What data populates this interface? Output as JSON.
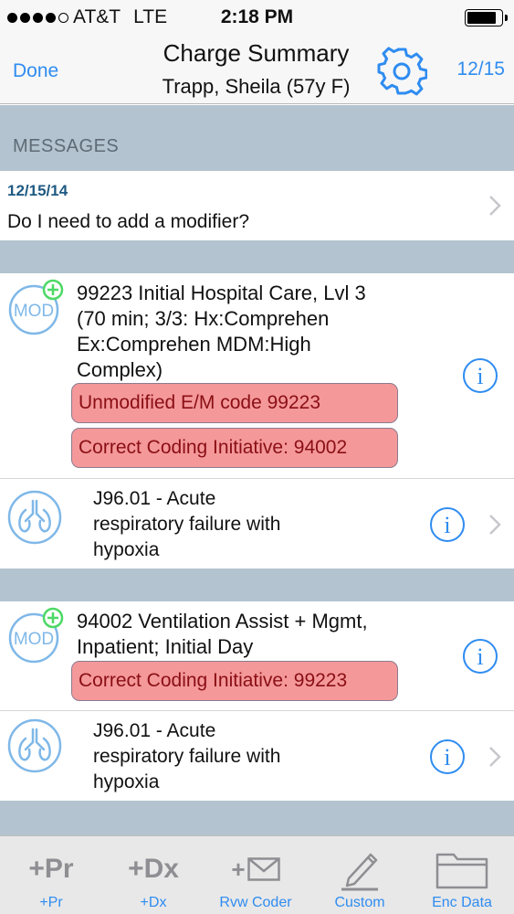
{
  "status_bar": {
    "carrier": "AT&T",
    "network": "LTE",
    "time": "2:18 PM",
    "signal_bars": 4,
    "battery_level": 0.85
  },
  "navbar": {
    "done_label": "Done",
    "title": "Charge Summary",
    "subtitle": "Trapp, Sheila (57y F)",
    "date": "12/15",
    "settings_icon": "gear-icon"
  },
  "messages": {
    "header": "MESSAGES",
    "items": [
      {
        "date": "12/15/14",
        "text": "Do I need to add a modifier?"
      }
    ]
  },
  "charges": [
    {
      "procedure": "99223 Initial Hospital Care, Lvl 3\n(70 min; 3/3: Hx:Comprehen\nEx:Comprehen   MDM:High\nComplex)",
      "alerts": [
        "Unmodified E/M code 99223",
        "Correct Coding Initiative: 94002"
      ],
      "diagnosis": "J96.01 - Acute\nrespiratory failure with\nhypoxia",
      "mod_label": "MOD"
    },
    {
      "procedure": "94002 Ventilation Assist + Mgmt,\nInpatient; Initial Day",
      "alerts": [
        "Correct Coding Initiative: 99223"
      ],
      "diagnosis": "J96.01 - Acute\nrespiratory failure with\nhypoxia",
      "mod_label": "MOD"
    }
  ],
  "tabbar": {
    "items": [
      {
        "glyph": "+Pr",
        "label": "+Pr"
      },
      {
        "glyph": "+Dx",
        "label": "+Dx"
      },
      {
        "glyph": "+",
        "label": "Rvw Coder",
        "icon": "envelope-icon"
      },
      {
        "label": "Custom",
        "icon": "pencil-icon"
      },
      {
        "label": "Enc Data",
        "icon": "folder-icon"
      }
    ]
  },
  "colors": {
    "accent": "#2f8cf0",
    "section_bg": "#b3c3cf",
    "alert_bg": "#f4989a",
    "alert_text": "#8a0f14",
    "mod_green": "#4cd964"
  }
}
